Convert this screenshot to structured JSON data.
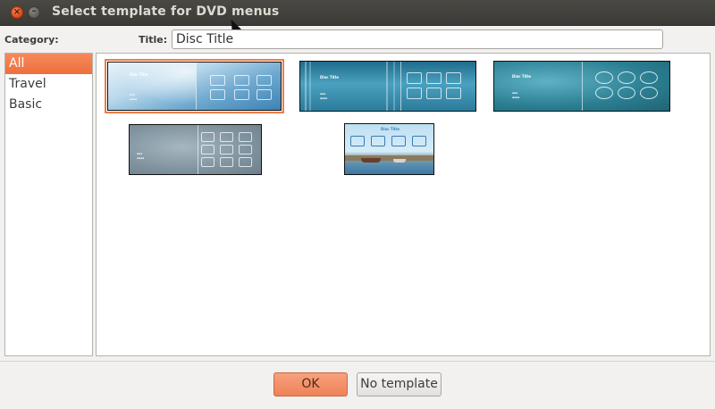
{
  "window": {
    "title": "Select template for DVD menus",
    "close_glyph": "×",
    "minimize_glyph": "–"
  },
  "category": {
    "label": "Category:",
    "items": [
      "All",
      "Travel",
      "Basic"
    ],
    "selected": "All"
  },
  "title_field": {
    "label": "Title:",
    "value": "Disc Title"
  },
  "templates": [
    {
      "name": "template-1",
      "preview_title": "Disc Title",
      "selected": true
    },
    {
      "name": "template-2",
      "preview_title": "Disc Title",
      "selected": false
    },
    {
      "name": "template-3",
      "preview_title": "Disc Title",
      "selected": false
    },
    {
      "name": "template-4",
      "preview_title": "",
      "selected": false
    },
    {
      "name": "template-5",
      "preview_title": "Disc Title",
      "selected": false
    }
  ],
  "buttons": {
    "ok": "OK",
    "no_template": "No template"
  },
  "colors": {
    "accent": "#ee7b48",
    "titlebar": "#3c3b37"
  }
}
